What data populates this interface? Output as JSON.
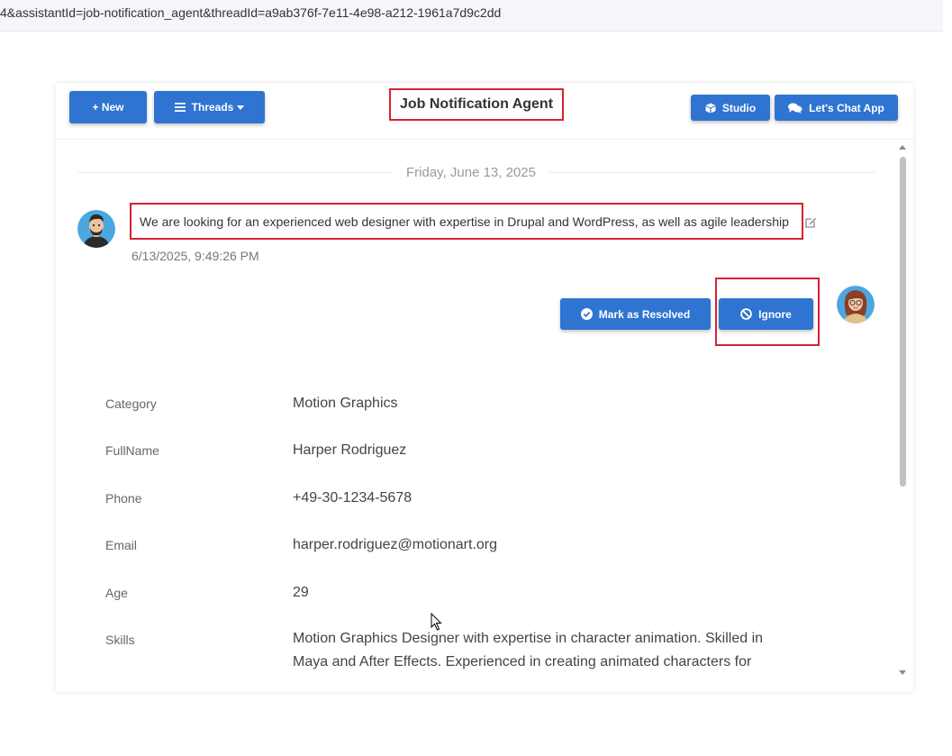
{
  "browser": {
    "url_fragment": "4&assistantId=job-notification_agent&threadId=a9ab376f-7e11-4e98-a212-1961a7d9c2dd"
  },
  "header": {
    "new_label": "+ New",
    "threads_label": "Threads",
    "title": "Job Notification Agent",
    "studio_label": "Studio",
    "chat_app_label": "Let's Chat App"
  },
  "chat": {
    "date": "Friday, June 13, 2025",
    "message": "We are looking for an experienced web designer with expertise in Drupal and WordPress, as well as agile leadership",
    "timestamp": "6/13/2025, 9:49:26 PM"
  },
  "actions": {
    "resolve_label": "Mark as Resolved",
    "ignore_label": "Ignore"
  },
  "details": [
    {
      "label": "Category",
      "value": "Motion Graphics"
    },
    {
      "label": "FullName",
      "value": "Harper Rodriguez"
    },
    {
      "label": "Phone",
      "value": "+49-30-1234-5678"
    },
    {
      "label": "Email",
      "value": "harper.rodriguez@motionart.org"
    },
    {
      "label": "Age",
      "value": "29"
    },
    {
      "label": "Skills",
      "value": "Motion Graphics Designer with expertise in character animation. Skilled in Maya and After Effects. Experienced in creating animated characters for commercials."
    }
  ],
  "icons": {
    "threads": "bars-icon",
    "studio": "cube-icon",
    "chat_app": "comments-icon",
    "resolve": "check-circle-icon",
    "ignore": "ban-icon",
    "edit": "edit-icon"
  },
  "colors": {
    "primary_button": "#2f74d0",
    "highlight_border": "#d5232f"
  }
}
